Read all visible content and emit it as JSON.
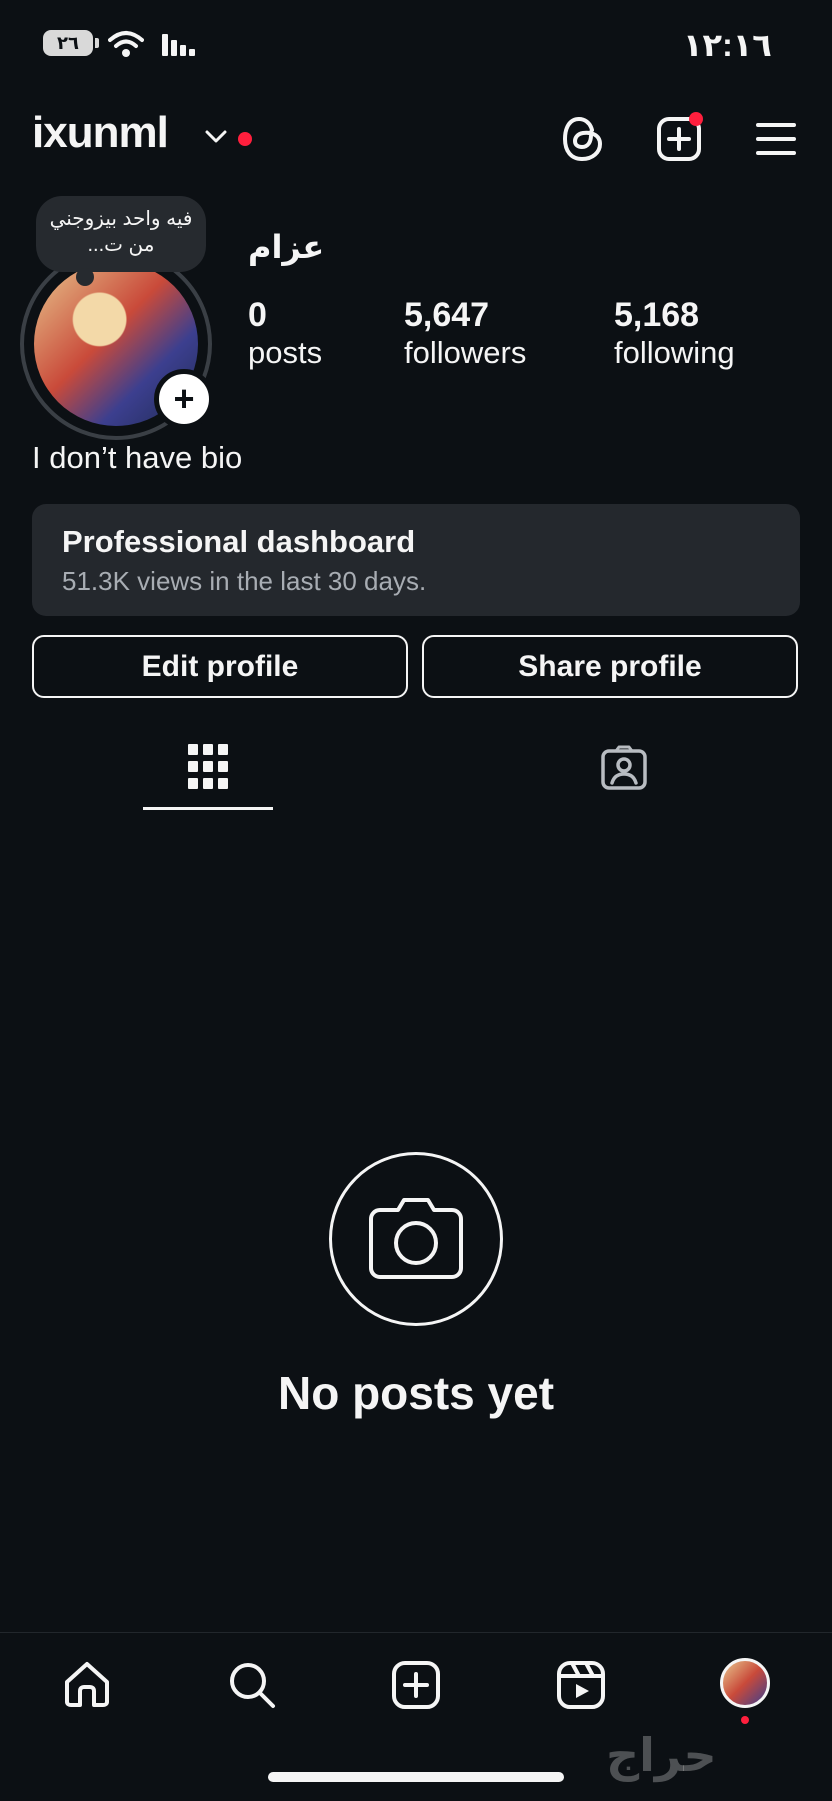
{
  "status_bar": {
    "time": "١٢:١٦",
    "battery": "٢٦"
  },
  "header": {
    "username": "ixunml"
  },
  "profile": {
    "note": "فيه واحد بيزوجني من ت...",
    "display_name": "عزام",
    "stats": [
      {
        "value": "0",
        "label": "posts"
      },
      {
        "value": "5,647",
        "label": "followers"
      },
      {
        "value": "5,168",
        "label": "following"
      }
    ],
    "bio": "I don’t have bio"
  },
  "dashboard": {
    "title": "Professional dashboard",
    "subtitle": "51.3K views in the last 30 days."
  },
  "buttons": {
    "edit": "Edit profile",
    "share": "Share profile"
  },
  "empty_state": {
    "text": "No posts yet"
  },
  "watermark": "حراج",
  "colors": {
    "background": "#0c1014",
    "notification": "#ff1f3d",
    "card": "#24282d"
  }
}
